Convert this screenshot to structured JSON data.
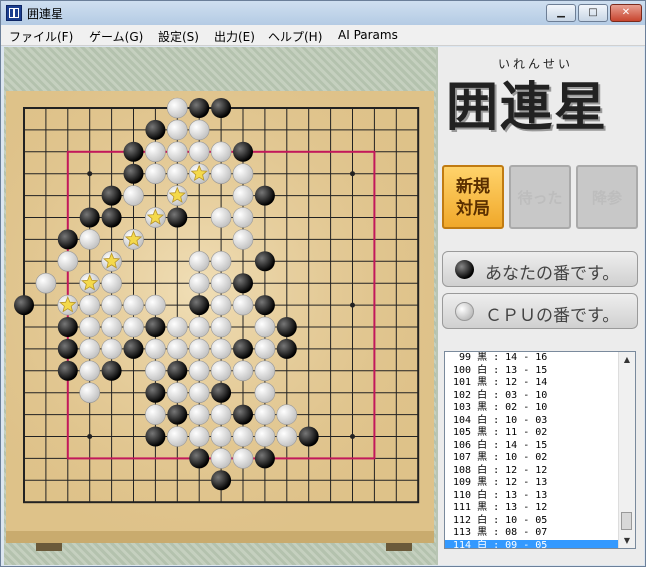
{
  "window": {
    "title": "囲連星",
    "minimize": "▁",
    "maximize": "□",
    "close": "✕"
  },
  "menu": [
    {
      "label": "ファイル(F)"
    },
    {
      "label": "ゲーム(G)"
    },
    {
      "label": "設定(S)"
    },
    {
      "label": "出力(E)"
    },
    {
      "label": "ヘルプ(H)"
    },
    {
      "label": "AI Params"
    }
  ],
  "logo": {
    "furigana": "いれんせい",
    "text": "囲連星"
  },
  "buttons": {
    "new_game": "新規\n対局",
    "wait": "待った",
    "resign": "降参"
  },
  "turn": {
    "black_label": "あなたの番です。",
    "cpu_label": "ＣＰＵの番です。"
  },
  "moves": [
    {
      "n": "99",
      "color": "黒",
      "pos": "14 - 16"
    },
    {
      "n": "100",
      "color": "白",
      "pos": "13 - 15"
    },
    {
      "n": "101",
      "color": "黒",
      "pos": "12 - 14"
    },
    {
      "n": "102",
      "color": "白",
      "pos": "03 - 10"
    },
    {
      "n": "103",
      "color": "黒",
      "pos": "02 - 10"
    },
    {
      "n": "104",
      "color": "白",
      "pos": "10 - 03"
    },
    {
      "n": "105",
      "color": "黒",
      "pos": "11 - 02"
    },
    {
      "n": "106",
      "color": "白",
      "pos": "14 - 15"
    },
    {
      "n": "107",
      "color": "黒",
      "pos": "10 - 02"
    },
    {
      "n": "108",
      "color": "白",
      "pos": "12 - 12"
    },
    {
      "n": "109",
      "color": "黒",
      "pos": "12 - 13"
    },
    {
      "n": "110",
      "color": "白",
      "pos": "13 - 13"
    },
    {
      "n": "111",
      "color": "黒",
      "pos": "13 - 12"
    },
    {
      "n": "112",
      "color": "白",
      "pos": "10 - 05"
    },
    {
      "n": "113",
      "color": "黒",
      "pos": "08 - 07"
    },
    {
      "n": "114",
      "color": "白",
      "pos": "09 - 05"
    }
  ],
  "selected_move": 15,
  "board": {
    "size": 19,
    "black": [
      [
        8,
        0
      ],
      [
        9,
        0
      ],
      [
        6,
        1
      ],
      [
        5,
        2
      ],
      [
        10,
        2
      ],
      [
        5,
        3
      ],
      [
        4,
        4
      ],
      [
        11,
        4
      ],
      [
        3,
        5
      ],
      [
        4,
        5
      ],
      [
        7,
        5
      ],
      [
        2,
        6
      ],
      [
        4,
        7
      ],
      [
        11,
        7
      ],
      [
        1,
        8
      ],
      [
        10,
        8
      ],
      [
        0,
        9
      ],
      [
        8,
        9
      ],
      [
        11,
        9
      ],
      [
        2,
        10
      ],
      [
        6,
        10
      ],
      [
        12,
        10
      ],
      [
        2,
        11
      ],
      [
        5,
        11
      ],
      [
        10,
        11
      ],
      [
        12,
        11
      ],
      [
        2,
        12
      ],
      [
        4,
        12
      ],
      [
        7,
        12
      ],
      [
        6,
        13
      ],
      [
        9,
        13
      ],
      [
        7,
        14
      ],
      [
        10,
        14
      ],
      [
        6,
        15
      ],
      [
        13,
        15
      ],
      [
        8,
        16
      ],
      [
        11,
        16
      ],
      [
        9,
        17
      ]
    ],
    "white": [
      [
        7,
        0
      ],
      [
        7,
        1
      ],
      [
        8,
        1
      ],
      [
        6,
        2
      ],
      [
        7,
        2
      ],
      [
        8,
        2
      ],
      [
        9,
        2
      ],
      [
        6,
        3
      ],
      [
        7,
        3
      ],
      [
        9,
        3
      ],
      [
        10,
        3
      ],
      [
        5,
        4
      ],
      [
        10,
        4
      ],
      [
        6,
        5
      ],
      [
        9,
        5
      ],
      [
        10,
        5
      ],
      [
        3,
        6
      ],
      [
        5,
        6
      ],
      [
        10,
        6
      ],
      [
        2,
        7
      ],
      [
        8,
        7
      ],
      [
        9,
        7
      ],
      [
        1,
        8
      ],
      [
        3,
        8
      ],
      [
        4,
        8
      ],
      [
        8,
        8
      ],
      [
        9,
        8
      ],
      [
        3,
        9
      ],
      [
        4,
        9
      ],
      [
        5,
        9
      ],
      [
        6,
        9
      ],
      [
        9,
        9
      ],
      [
        10,
        9
      ],
      [
        3,
        10
      ],
      [
        4,
        10
      ],
      [
        5,
        10
      ],
      [
        7,
        10
      ],
      [
        8,
        10
      ],
      [
        9,
        10
      ],
      [
        11,
        10
      ],
      [
        3,
        11
      ],
      [
        4,
        11
      ],
      [
        6,
        11
      ],
      [
        7,
        11
      ],
      [
        8,
        11
      ],
      [
        9,
        11
      ],
      [
        11,
        11
      ],
      [
        3,
        12
      ],
      [
        6,
        12
      ],
      [
        8,
        12
      ],
      [
        9,
        12
      ],
      [
        10,
        12
      ],
      [
        11,
        12
      ],
      [
        3,
        13
      ],
      [
        7,
        13
      ],
      [
        8,
        13
      ],
      [
        11,
        13
      ],
      [
        6,
        14
      ],
      [
        8,
        14
      ],
      [
        9,
        14
      ],
      [
        11,
        14
      ],
      [
        12,
        14
      ],
      [
        7,
        15
      ],
      [
        8,
        15
      ],
      [
        9,
        15
      ],
      [
        10,
        15
      ],
      [
        11,
        15
      ],
      [
        12,
        15
      ],
      [
        9,
        16
      ],
      [
        10,
        16
      ]
    ],
    "stars_on_white": [
      [
        8,
        3
      ],
      [
        7,
        4
      ],
      [
        6,
        5
      ],
      [
        5,
        6
      ],
      [
        4,
        7
      ],
      [
        3,
        8
      ],
      [
        2,
        9
      ]
    ],
    "box": [
      2,
      2,
      16,
      16
    ],
    "hoshi": [
      [
        3,
        3
      ],
      [
        9,
        3
      ],
      [
        15,
        3
      ],
      [
        3,
        9
      ],
      [
        9,
        9
      ],
      [
        15,
        9
      ],
      [
        3,
        15
      ],
      [
        9,
        15
      ],
      [
        15,
        15
      ]
    ]
  },
  "colors": {
    "frame": "#c2185b",
    "star": "#f4d94b",
    "board": "#e2c891"
  }
}
